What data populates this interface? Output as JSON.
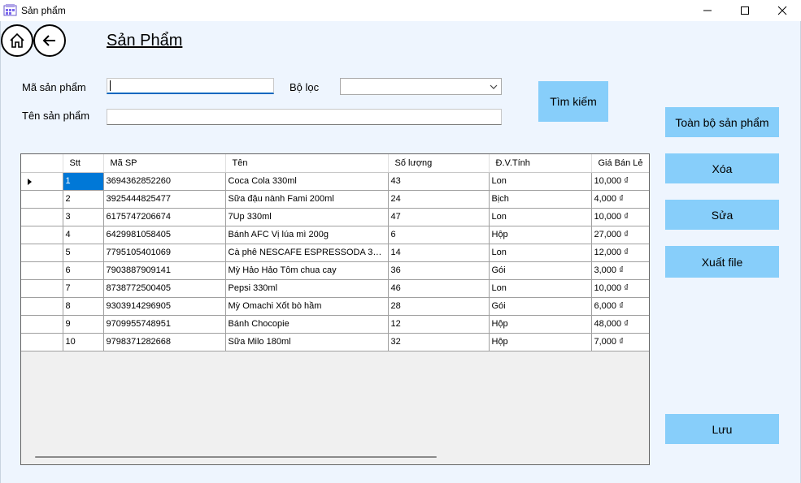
{
  "window": {
    "title": "Sản phẩm",
    "controls": [
      "minimize-icon",
      "maximize-icon",
      "close-icon"
    ]
  },
  "header": {
    "title": "Sản Phẩm",
    "icons": [
      "home-icon",
      "back-arrow-icon"
    ]
  },
  "form": {
    "code_label": "Mã sản phẩm",
    "code_value": "",
    "filter_label": "Bộ lọc",
    "filter_value": "",
    "name_label": "Tên sản phẩm",
    "name_value": ""
  },
  "buttons": {
    "search": "Tìm kiếm",
    "all_products": "Toàn bộ sản phẩm",
    "delete": "Xóa",
    "edit": "Sửa",
    "export": "Xuất file",
    "save": "Lưu"
  },
  "table": {
    "columns": [
      "Stt",
      "Mã SP",
      "Tên",
      "Số lượng",
      "Đ.V.Tính",
      "Giá Bán Lẻ"
    ],
    "rows": [
      [
        "1",
        "3694362852260",
        "Coca Cola 330ml",
        "43",
        "Lon",
        "10,000 ₫"
      ],
      [
        "2",
        "3925444825477",
        "Sữa đậu nành Fami 200ml",
        "24",
        "Bịch",
        "4,000 ₫"
      ],
      [
        "3",
        "6175747206674",
        "7Up 330ml",
        "47",
        "Lon",
        "10,000 ₫"
      ],
      [
        "4",
        "6429981058405",
        "Bánh AFC Vị lúa mì 200g",
        "6",
        "Hộp",
        "27,000 ₫"
      ],
      [
        "5",
        "7795105401069",
        "Cà phê NESCAFE ESPRESSODA 330...",
        "14",
        "Lon",
        "12,000 ₫"
      ],
      [
        "6",
        "7903887909141",
        "Mỳ Hảo Hảo Tôm chua cay",
        "36",
        "Gói",
        "3,000 ₫"
      ],
      [
        "7",
        "8738772500405",
        "Pepsi 330ml",
        "46",
        "Lon",
        "10,000 ₫"
      ],
      [
        "8",
        "9303914296905",
        "Mỳ Omachi Xốt bò hầm",
        "28",
        "Gói",
        "6,000 ₫"
      ],
      [
        "9",
        "9709955748951",
        "Bánh Chocopie",
        "12",
        "Hộp",
        "48,000 ₫"
      ],
      [
        "10",
        "9798371282668",
        "Sữa Milo 180ml",
        "32",
        "Hộp",
        "7,000 ₫"
      ]
    ],
    "selected_row": 0
  },
  "colors": {
    "button_bg": "#87cefa",
    "selection": "#0078d7",
    "background": "#eef5fe"
  }
}
